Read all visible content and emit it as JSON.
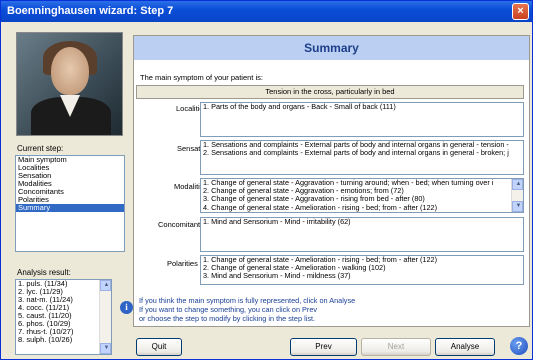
{
  "window": {
    "title": "Boenninghausen wizard: Step 7",
    "close_glyph": "×"
  },
  "summary_header": "Summary",
  "main_symptom_label": "The main symptom of your patient is:",
  "main_symptom_value": "Tension in the cross, particularly in bed",
  "sections": {
    "localities": {
      "label": "Localities",
      "lines": [
        "1. Parts of the body and organs - Back - Small of back (111)"
      ]
    },
    "sensation": {
      "label": "Sensation",
      "lines": [
        "1. Sensations and complaints - External parts of body and internal organs in general - tension -",
        "2. Sensations and complaints - External parts of body and internal organs in general - broken; j"
      ]
    },
    "modalities": {
      "label": "Modalities",
      "lines": [
        "1. Change of general state - Aggravation - turning around; when - bed; when turning over i",
        "2. Change of general state - Aggravation - emotions; from (72)",
        "3. Change of general state - Aggravation - rising from bed - after (80)",
        "4. Change of general state - Amelioration - rising - bed; from - after (122)"
      ]
    },
    "concomitants": {
      "label": "Concomitants",
      "lines": [
        "1. Mind and Sensorium - Mind - irritability (62)"
      ]
    },
    "polarities": {
      "label": "Polarities",
      "lines": [
        "1. Change of general state - Amelioration - rising - bed; from - after (122)",
        "2. Change of general state - Amelioration - walking (102)",
        "3. Mind and Sensorium - Mind - mildness (37)"
      ]
    }
  },
  "current_step_label": "Current step:",
  "steps": [
    "Main symptom",
    "Localities",
    "Sensation",
    "Modalities",
    "Concomitants",
    "Polarities",
    "Summary"
  ],
  "selected_step": "Summary",
  "analysis_label": "Analysis result:",
  "analysis": [
    "1. puls. (11/34)",
    "2. lyc. (11/29)",
    "3. nat-m. (11/24)",
    "4. cocc. (11/21)",
    "5. caust. (11/20)",
    "6. phos. (10/29)",
    "7. rhus-t. (10/27)",
    "8. sulph. (10/26)"
  ],
  "info_lines": [
    "If you think the main symptom is fully represented, click on Analyse",
    "If you want to change something, you can click on Prev",
    "or choose the step to modify by clicking in the step list."
  ],
  "buttons": {
    "quit": "Quit",
    "prev": "Prev",
    "next": "Next",
    "analyse": "Analyse",
    "help_glyph": "?"
  },
  "icons": {
    "info": "i",
    "scroll_up": "▲",
    "scroll_down": "▼"
  }
}
